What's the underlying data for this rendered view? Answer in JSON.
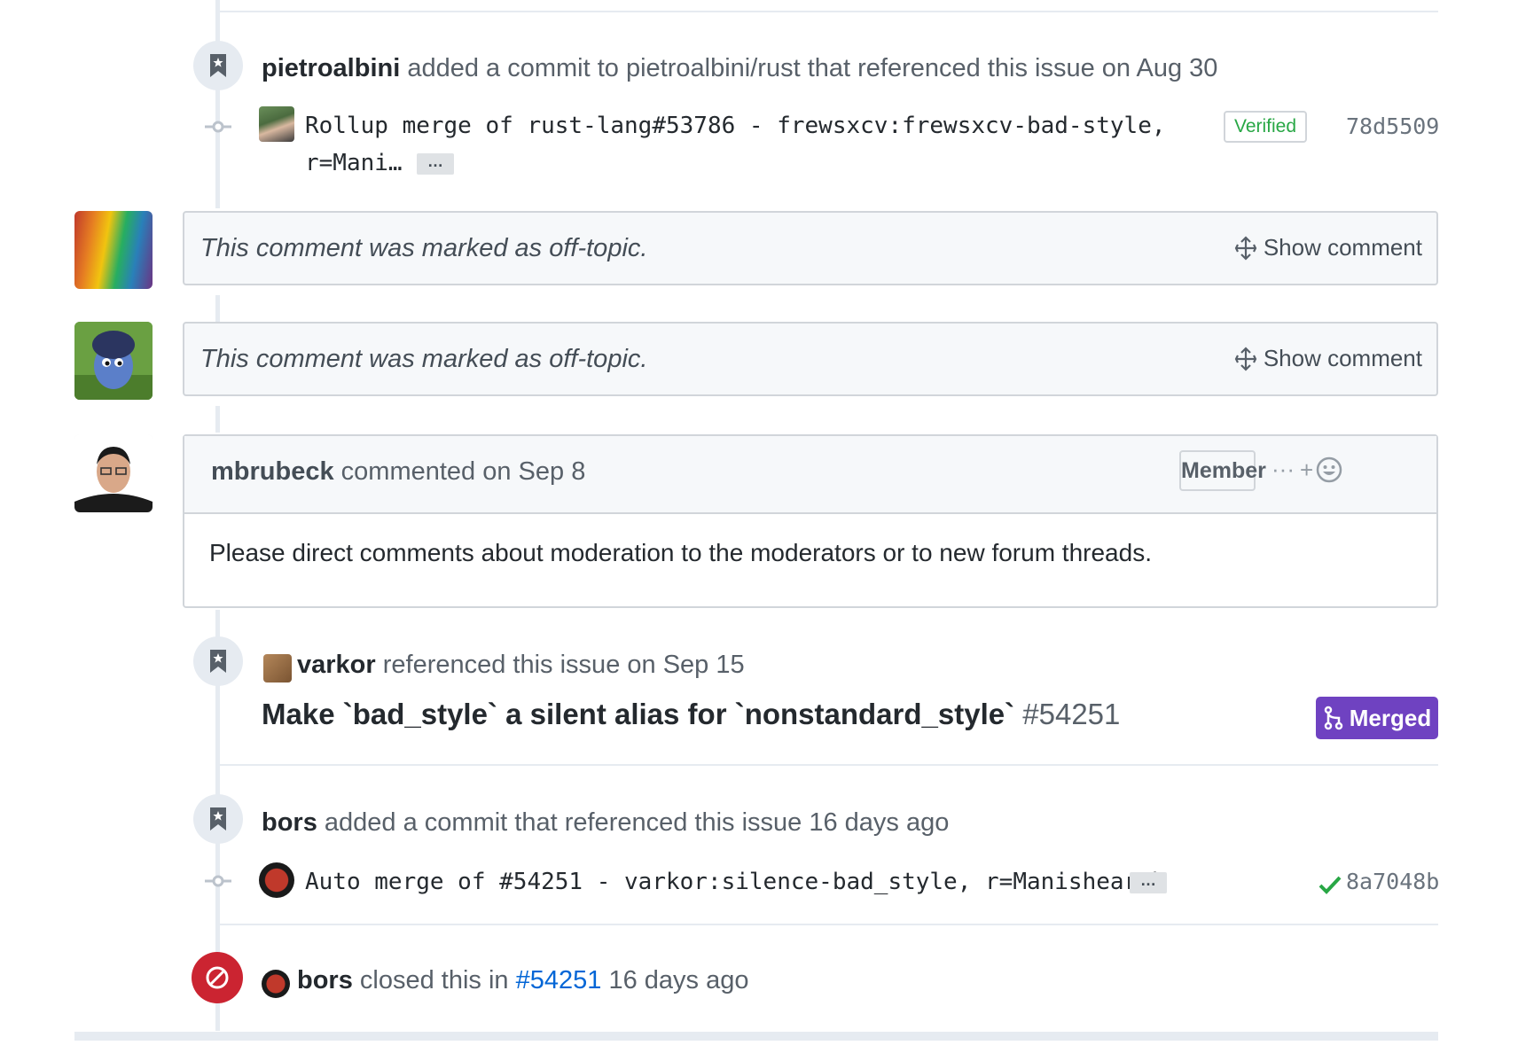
{
  "events": {
    "commit1": {
      "user": "pietroalbini",
      "text": "added a commit to pietroalbini/rust that referenced this issue on Aug 30",
      "commit_line1": "Rollup merge of rust-lang#53786 - frewsxcv:frewsxcv-bad-style,",
      "commit_line2": "r=Mani…",
      "ellipsis": "…",
      "verified": "Verified",
      "sha": "78d5509"
    },
    "offtopic": [
      {
        "text": "This comment was marked as off-topic.",
        "action": "Show comment"
      },
      {
        "text": "This comment was marked as off-topic.",
        "action": "Show comment"
      }
    ],
    "comment": {
      "author": "mbrubeck",
      "meta": "commented on Sep 8",
      "role": "Member",
      "add_reaction": "+",
      "more": "···",
      "body": "Please direct comments about moderation to the moderators or to new forum threads."
    },
    "reference": {
      "user": "varkor",
      "text": "referenced this issue on Sep 15",
      "pr_title": "Make `bad_style` a silent alias for `nonstandard_style`",
      "pr_number": "#54251",
      "status": "Merged"
    },
    "commit2": {
      "user": "bors",
      "text": "added a commit that referenced this issue 16 days ago",
      "commit_line": "Auto merge of #54251 - varkor:silence-bad_style, r=Manishearth",
      "ellipsis": "…",
      "sha": "8a7048b"
    },
    "closed": {
      "user": "bors",
      "text_before": "closed this in",
      "link": "#54251",
      "text_after": "16 days ago"
    }
  },
  "colors": {
    "link": "#0366d6",
    "merged": "#6f42c1",
    "closed": "#cb2431",
    "verified": "#28a745"
  }
}
